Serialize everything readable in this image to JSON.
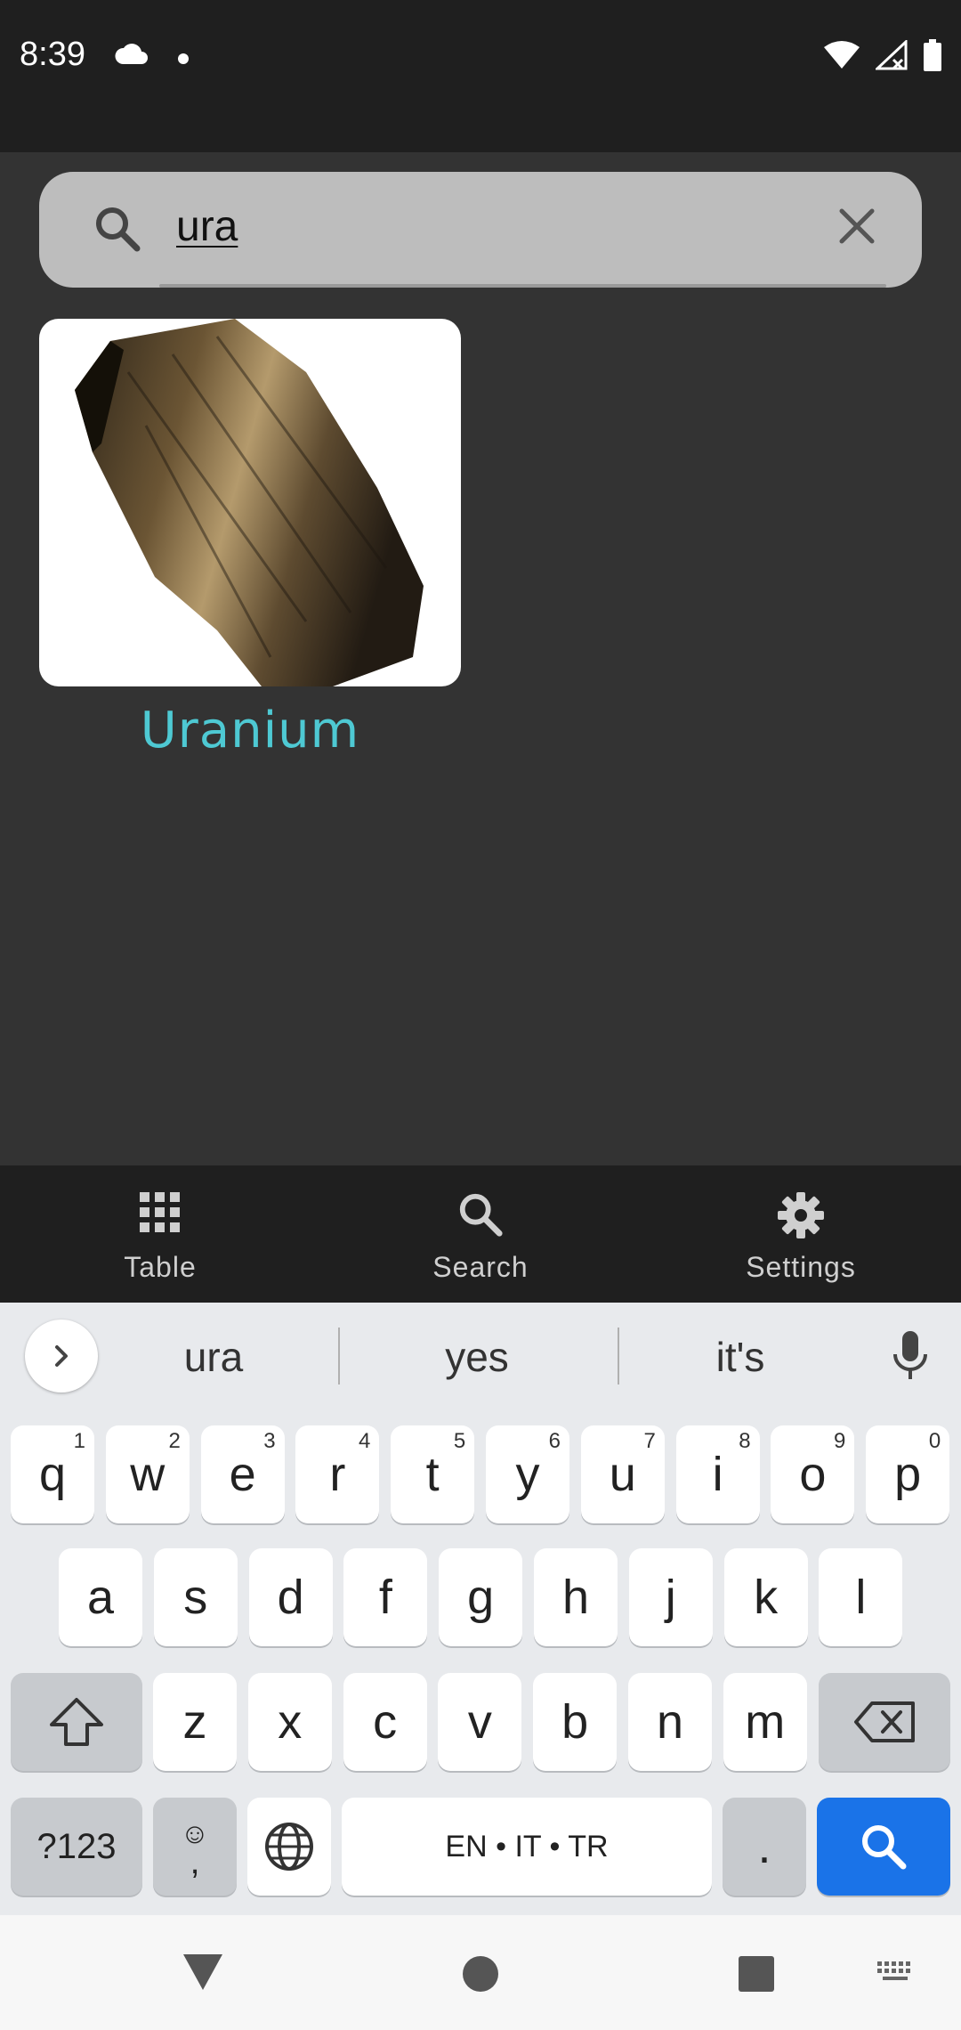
{
  "status_bar": {
    "time": "8:39"
  },
  "search": {
    "query": "ura"
  },
  "results": [
    {
      "name": "Uranium"
    }
  ],
  "bottom_nav": [
    {
      "label": "Table",
      "icon": "grid-icon"
    },
    {
      "label": "Search",
      "icon": "search-icon"
    },
    {
      "label": "Settings",
      "icon": "gear-icon"
    }
  ],
  "keyboard": {
    "suggestions": [
      "ura",
      "yes",
      "it's"
    ],
    "row1": [
      {
        "k": "q",
        "h": "1"
      },
      {
        "k": "w",
        "h": "2"
      },
      {
        "k": "e",
        "h": "3"
      },
      {
        "k": "r",
        "h": "4"
      },
      {
        "k": "t",
        "h": "5"
      },
      {
        "k": "y",
        "h": "6"
      },
      {
        "k": "u",
        "h": "7"
      },
      {
        "k": "i",
        "h": "8"
      },
      {
        "k": "o",
        "h": "9"
      },
      {
        "k": "p",
        "h": "0"
      }
    ],
    "row2": [
      "a",
      "s",
      "d",
      "f",
      "g",
      "h",
      "j",
      "k",
      "l"
    ],
    "row3": [
      "z",
      "x",
      "c",
      "v",
      "b",
      "n",
      "m"
    ],
    "symbols_label": "?123",
    "emoji_comma": ",",
    "space_label": "EN • IT • TR",
    "period": "."
  },
  "colors": {
    "accent": "#4ec9d3",
    "search_key": "#1a73e8"
  }
}
